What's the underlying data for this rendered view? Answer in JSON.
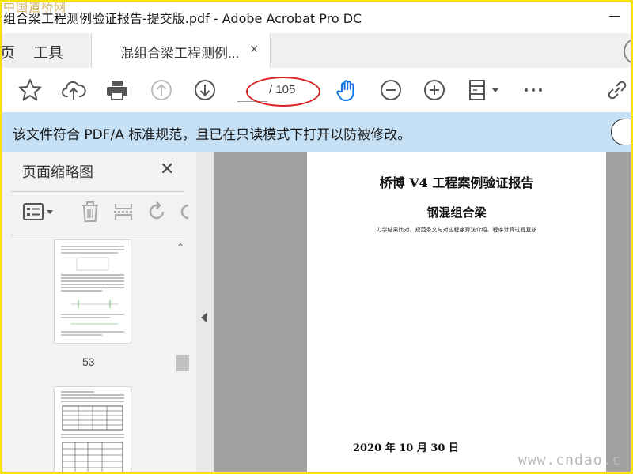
{
  "window": {
    "title": "组合梁工程测例验证报告-提交版.pdf - Adobe Acrobat Pro DC"
  },
  "watermarks": {
    "top_left": "中国道桥网",
    "bottom_right": "www.cndao.c"
  },
  "tabs": {
    "home": "页",
    "tools": "工具",
    "document": "混组合梁工程测例...",
    "close_glyph": "×"
  },
  "toolbar": {
    "current_page": "",
    "total_pages": "/ 105",
    "icons": [
      "star-icon",
      "cloud-upload-icon",
      "print-icon",
      "page-up-icon",
      "page-down-icon",
      "hand-icon",
      "zoom-out-icon",
      "zoom-in-icon",
      "fit-page-icon",
      "more-icon",
      "link-icon"
    ],
    "colors": {
      "hand_active": "#1473e6",
      "annotation_ellipse": "#d9201f"
    }
  },
  "notice": {
    "message": "该文件符合 PDF/A 标准规范，且已在只读模式下打开以防被修改。",
    "colors": {
      "background": "#c6e1f6"
    }
  },
  "panel": {
    "title": "页面缩略图",
    "close_glyph": "✕",
    "thumbnails": [
      {
        "label": "53"
      },
      {
        "label": ""
      }
    ]
  },
  "document": {
    "title": "桥博 V4 工程案例验证报告",
    "subtitle": "钢混组合梁",
    "description": "力学结果比对、规范条文与对应程序算法介绍、程序计算过程复核",
    "date": "2020 年 10 月 30 日"
  }
}
